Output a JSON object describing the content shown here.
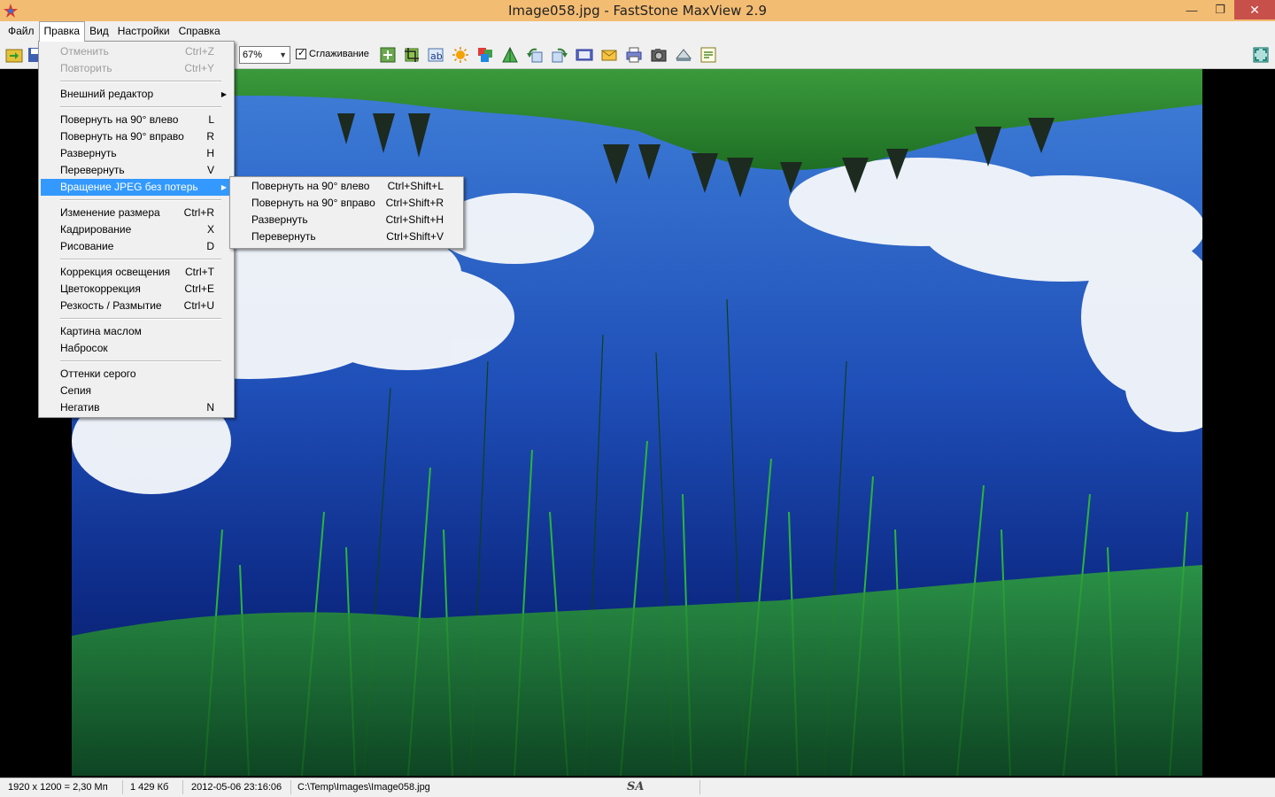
{
  "window": {
    "title": "Image058.jpg - FastStone MaxView 2.9",
    "minimize_glyph": "—",
    "restore_glyph": "❐",
    "close_glyph": "✕",
    "icon": "faststone-app-icon"
  },
  "menubar": {
    "items": [
      "Файл",
      "Правка",
      "Вид",
      "Настройки",
      "Справка"
    ]
  },
  "toolbar": {
    "zoom_value": "67%",
    "smoothing_label": "Сглаживание",
    "smoothing_checked": true,
    "icons": [
      "open-folder-icon",
      "save-icon",
      "add-icon",
      "crop-icon",
      "text-icon",
      "brightness-icon",
      "color-icon",
      "sharpen-icon",
      "rotate-left-icon",
      "rotate-right-icon",
      "slideshow-icon",
      "email-icon",
      "print-icon",
      "screenshot-icon",
      "scanner-icon",
      "settings-icon",
      "fullscreen-icon"
    ]
  },
  "edit_menu": {
    "groups": [
      [
        {
          "label": "Отменить",
          "shortcut": "Ctrl+Z",
          "disabled": true
        },
        {
          "label": "Повторить",
          "shortcut": "Ctrl+Y",
          "disabled": true
        }
      ],
      [
        {
          "label": "Внешний редактор",
          "shortcut": "",
          "submenu": true
        }
      ],
      [
        {
          "label": "Повернуть на 90° влево",
          "shortcut": "L"
        },
        {
          "label": "Повернуть на 90° вправо",
          "shortcut": "R"
        },
        {
          "label": "Развернуть",
          "shortcut": "H"
        },
        {
          "label": "Перевернуть",
          "shortcut": "V"
        },
        {
          "label": "Вращение JPEG без потерь",
          "shortcut": "",
          "submenu": true,
          "highlighted": true
        }
      ],
      [
        {
          "label": "Изменение размера",
          "shortcut": "Ctrl+R"
        },
        {
          "label": "Кадрирование",
          "shortcut": "X"
        },
        {
          "label": "Рисование",
          "shortcut": "D"
        }
      ],
      [
        {
          "label": "Коррекция освещения",
          "shortcut": "Ctrl+T"
        },
        {
          "label": "Цветокоррекция",
          "shortcut": "Ctrl+E"
        },
        {
          "label": "Резкость / Размытие",
          "shortcut": "Ctrl+U"
        }
      ],
      [
        {
          "label": "Картина маслом",
          "shortcut": ""
        },
        {
          "label": "Набросок",
          "shortcut": ""
        }
      ],
      [
        {
          "label": "Оттенки серого",
          "shortcut": ""
        },
        {
          "label": "Сепия",
          "shortcut": ""
        },
        {
          "label": "Негатив",
          "shortcut": "N"
        }
      ]
    ]
  },
  "jpeg_submenu": {
    "items": [
      {
        "label": "Повернуть на 90° влево",
        "shortcut": "Ctrl+Shift+L"
      },
      {
        "label": "Повернуть на 90° вправо",
        "shortcut": "Ctrl+Shift+R"
      },
      {
        "label": "Развернуть",
        "shortcut": "Ctrl+Shift+H"
      },
      {
        "label": "Перевернуть",
        "shortcut": "Ctrl+Shift+V"
      }
    ]
  },
  "statusbar": {
    "dimensions": "1920 x 1200 = 2,30 Мп",
    "filesize": "1 429 Кб",
    "datetime": "2012-05-06 23:16:06",
    "path": "C:\\Temp\\Images\\Image058.jpg",
    "logo": "SA"
  }
}
